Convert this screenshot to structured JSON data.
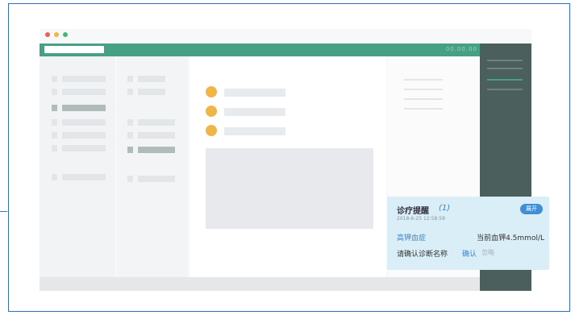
{
  "window": {
    "dots": [
      "#e8605a",
      "#f3b33c",
      "#44b67a"
    ],
    "header_right": "00.00.00"
  },
  "reminder": {
    "title": "诊疗提醒",
    "count": "(1)",
    "datetime": "2018-6-25  12:58:58",
    "expand_label": "展开",
    "diagnosis": "高钾血症",
    "current_value": "当前血钾4.5mmol/L",
    "prompt": "请确认诊断名称",
    "confirm_label": "确认",
    "ignore_label": "忽略"
  }
}
